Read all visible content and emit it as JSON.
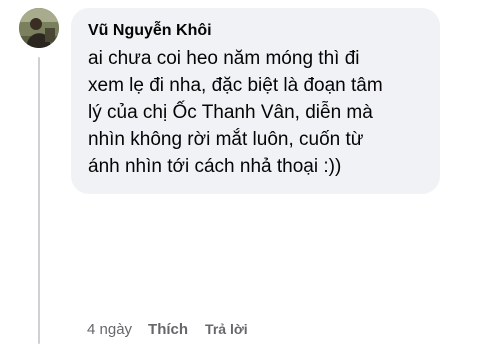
{
  "comment": {
    "author": "Vũ Nguyễn Khôi",
    "text": "ai chưa coi heo năm móng thì đi\nxem lẹ đi nha, đặc biệt là đoạn tâm\nlý của chị Ốc Thanh Vân, diễn mà\nnhìn không rời mắt luôn, cuốn từ\nánh nhìn tới cách nhả thoại :))",
    "timestamp": "4 ngày",
    "like_label": "Thích",
    "reply_label": "Trả lời"
  },
  "colors": {
    "bubble_background": "#f0f2f5",
    "text": "#050505",
    "secondary_text": "#65676b",
    "thread_line": "#ced0d4"
  }
}
